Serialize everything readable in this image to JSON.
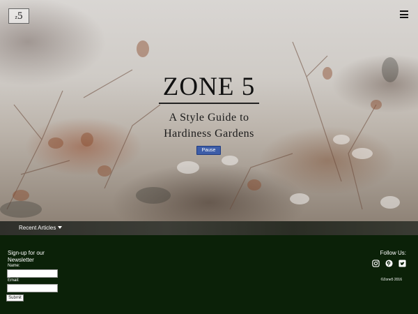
{
  "header": {
    "logo_z": "z",
    "logo_five": "5",
    "menu_icon": "hamburger-menu-icon"
  },
  "hero": {
    "title": "ZONE 5",
    "subtitle_line1": "A Style Guide to",
    "subtitle_line2": "Hardiness Gardens",
    "pause_label": "Pause"
  },
  "recent": {
    "label": "Recent Articles",
    "icon": "caret-down-icon"
  },
  "footer": {
    "signup_title": "Sign-up for our Newsletter",
    "name_label": "Name:",
    "name_value": "",
    "email_label": "Email:",
    "email_value": "",
    "submit_label": "Submit",
    "follow_label": "Follow Us:",
    "social": [
      "instagram-icon",
      "pinterest-icon",
      "twitter-icon"
    ],
    "copyright": "©Zone5 2016"
  },
  "colors": {
    "footer_bg": "#0b2108",
    "pause_bg": "#3d5da8",
    "bar_bg": "#35362f"
  }
}
